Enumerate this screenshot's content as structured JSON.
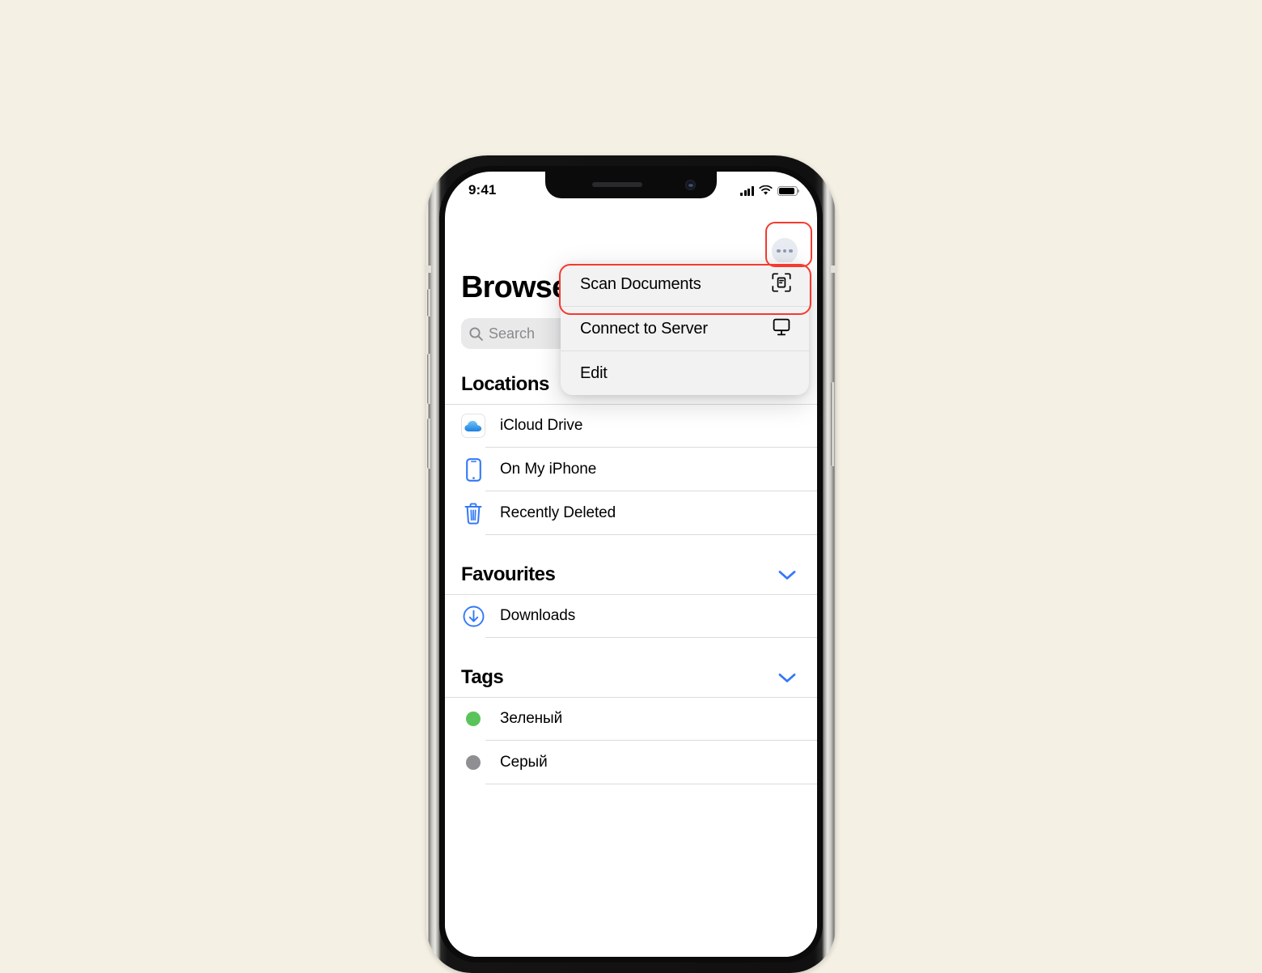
{
  "background_color": "#f4f0e3",
  "device": {
    "name": "iPhone",
    "hardware": {
      "silent_switch": "silent-switch",
      "volume_up": "volume-up-button",
      "volume_down": "volume-down-button",
      "power": "power-button"
    }
  },
  "status_bar": {
    "time": "9:41",
    "cellular_icon": "cellular-signal-icon",
    "wifi_icon": "wifi-icon",
    "battery_icon": "battery-icon"
  },
  "nav": {
    "more_button_label": "More",
    "more_icon": "ellipsis-circle-icon"
  },
  "header": {
    "title": "Browse"
  },
  "search": {
    "placeholder": "Search",
    "value": "",
    "icon": "search-icon"
  },
  "sections": [
    {
      "title": "Locations",
      "collapse_icon": "chevron-down-icon",
      "rows": [
        {
          "label": "iCloud Drive",
          "icon": "icloud-drive-icon"
        },
        {
          "label": "On My iPhone",
          "icon": "iphone-icon"
        },
        {
          "label": "Recently Deleted",
          "icon": "trash-icon"
        }
      ]
    },
    {
      "title": "Favourites",
      "collapse_icon": "chevron-down-icon",
      "rows": [
        {
          "label": "Downloads",
          "icon": "download-circle-icon"
        }
      ]
    },
    {
      "title": "Tags",
      "collapse_icon": "chevron-down-icon",
      "rows": [
        {
          "label": "Зеленый",
          "icon": "tag-dot",
          "color": "#5ac45a"
        },
        {
          "label": "Серый",
          "icon": "tag-dot",
          "color": "#8e8e93"
        }
      ]
    }
  ],
  "context_menu": {
    "items": [
      {
        "label": "Scan Documents",
        "icon": "document-scanner-icon"
      },
      {
        "label": "Connect to Server",
        "icon": "display-monitor-icon"
      },
      {
        "label": "Edit",
        "icon": ""
      }
    ]
  },
  "annotations": {
    "color": "#f6392f",
    "targets": [
      "more-button",
      "scan-documents-menu-item"
    ]
  }
}
